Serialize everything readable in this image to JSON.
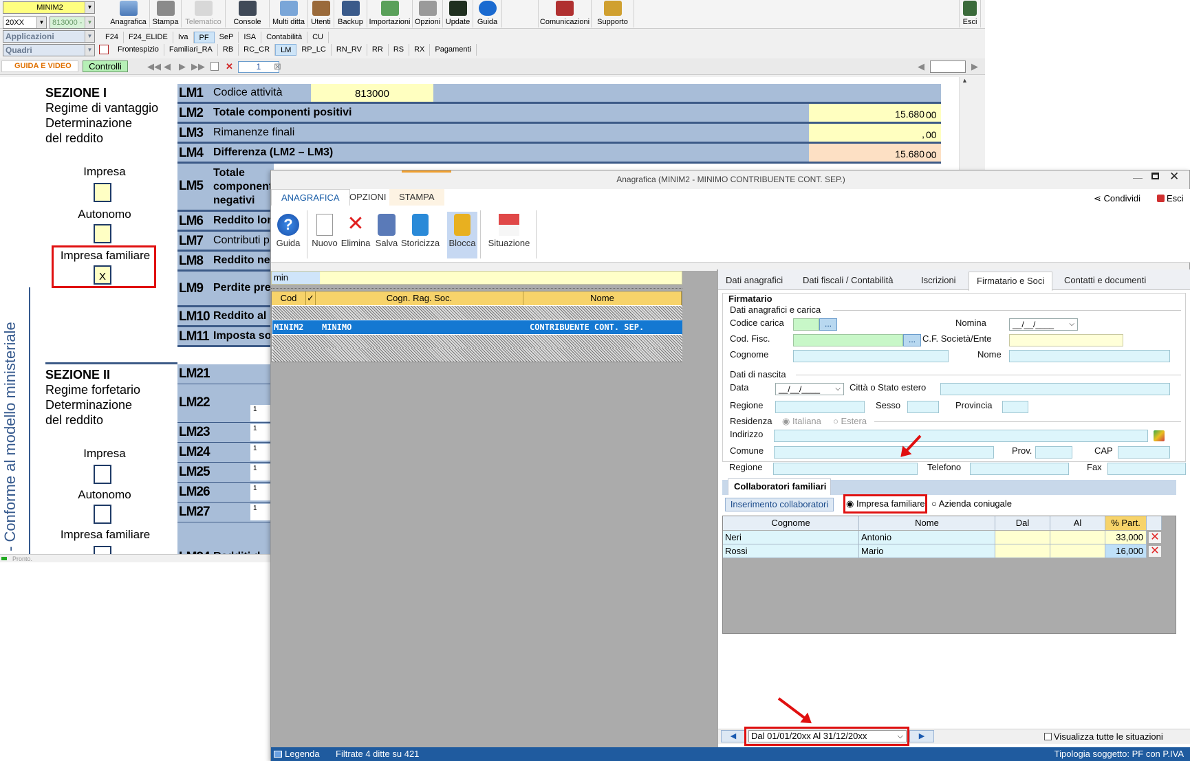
{
  "bg_app": {
    "company_combo": "MINIM2",
    "year_combo": "20XX",
    "code_combo": "813000 -",
    "applicazioni": "Applicazioni",
    "quadri": "Quadri",
    "toolbar": [
      "Anagrafica",
      "Stampa",
      "Telematico",
      "Console",
      "Multi ditta",
      "Utenti",
      "Backup",
      "Importazioni",
      "Opzioni",
      "Update",
      "Guida"
    ],
    "toolbar2": [
      "Comunicazioni",
      "Supporto"
    ],
    "esci": "Esci",
    "tabs1": [
      "F24",
      "F24_ELIDE",
      "Iva",
      "PF",
      "SeP",
      "ISA",
      "Contabilità",
      "CU"
    ],
    "tabs1_selected": "PF",
    "tabs2": [
      "Frontespizio",
      "Familiari_RA",
      "RB",
      "RC_CR",
      "LM",
      "RP_LC",
      "RN_RV",
      "RR",
      "RS",
      "RX",
      "Pagamenti"
    ],
    "tabs2_selected": "LM",
    "guida_video": "GUIDA E VIDEO",
    "controlli": "Controlli",
    "page_num": "1",
    "status": "Pronto.",
    "form": {
      "sez1_title": "SEZIONE I",
      "sez1_lines": [
        "Regime di vantaggio",
        "Determinazione",
        "del reddito"
      ],
      "impresa": "Impresa",
      "autonomo": "Autonomo",
      "impresa_familiare": "Impresa familiare",
      "x_mark": "X",
      "sez2_title": "SEZIONE II",
      "sez2_lines": [
        "Regime forfetario",
        "Determinazione",
        "del reddito"
      ],
      "side_text": "- Conforme al modello ministeriale",
      "lm1": "LM1",
      "lm1_text": "Codice attività",
      "lm1_value": "813000",
      "lm2": "LM2",
      "lm2_text": "Totale componenti positivi",
      "lm2_value": "15.680",
      "lm3": "LM3",
      "lm3_text": "Rimanenze finali",
      "lm3_value": ",",
      "lm4": "LM4",
      "lm4_text": "Differenza (LM2 – LM3)",
      "lm4_value": "15.680",
      "lm5": "LM5",
      "lm5_text": [
        "Totale",
        "component",
        "negativi"
      ],
      "lm6": "LM6",
      "lm6_text": "Reddito lor",
      "lm7": "LM7",
      "lm7_text": "Contributi p",
      "lm8": "LM8",
      "lm8_text": "Reddito net",
      "lm9": "LM9",
      "lm9_text": "Perdite pre",
      "lm10": "LM10",
      "lm10_text": "Reddito al",
      "lm11": "LM11",
      "lm11_text": "Imposta so",
      "lm21": "LM21",
      "lm22": "LM22",
      "lm23": "LM23",
      "lm24": "LM24",
      "lm25": "LM25",
      "lm26": "LM26",
      "lm27": "LM27",
      "lm34": "LM34",
      "lm34_text": "Redditi d",
      "one": "1",
      "dec_suffix": "00"
    }
  },
  "dialog": {
    "title": "Anagrafica (MINIM2 - MINIMO CONTRIBUENTE CONT. SEP.)",
    "ribbon_tabs": [
      "ANAGRAFICA",
      "OPZIONI",
      "STAMPA"
    ],
    "ribbon_selected": "ANAGRAFICA",
    "condividi": "Condividi",
    "esci": "Esci",
    "ribbon_buttons": [
      "Guida",
      "Nuovo",
      "Elimina",
      "Salva",
      "Storicizza",
      "Blocca",
      "Situazione"
    ],
    "search_value": "min",
    "grid_headers": [
      "Cod",
      "✓",
      "Cogn. Rag. Soc.",
      "Nome"
    ],
    "grid_selected": {
      "cod": "MINIM2",
      "cogn": "MINIMO",
      "nome": "CONTRIBUENTE CONT. SEP."
    },
    "section_tabs": [
      "Dati anagrafici",
      "Dati fiscali / Contabilità",
      "Iscrizioni",
      "Firmatario e Soci",
      "Contatti e documenti"
    ],
    "section_selected": "Firmatario e Soci",
    "firmatario": {
      "title": "Firmatario",
      "grp1": "Dati anagrafici e carica",
      "codice_carica": "Codice carica",
      "nomina": "Nomina",
      "date_placeholder": "__/__/____",
      "cod_fisc": "Cod. Fisc.",
      "cf_soc": "C.F. Società/Ente",
      "cognome": "Cognome",
      "nome": "Nome",
      "grp2": "Dati di nascita",
      "data": "Data",
      "citta": "Città o Stato estero",
      "regione": "Regione",
      "sesso": "Sesso",
      "provincia": "Provincia",
      "residenza": "Residenza",
      "italiana": "Italiana",
      "estera": "Estera",
      "indirizzo": "Indirizzo",
      "comune": "Comune",
      "prov": "Prov.",
      "cap": "CAP",
      "regione2": "Regione",
      "telefono": "Telefono",
      "fax": "Fax",
      "dots": "..."
    },
    "collab": {
      "tab": "Collaboratori familiari",
      "inserimento": "Inserimento collaboratori",
      "opt_impresa": "Impresa familiare",
      "opt_azienda": "Azienda coniugale",
      "selected_option": "Impresa familiare",
      "headers": [
        "Cognome",
        "Nome",
        "Dal",
        "Al",
        "% Part."
      ],
      "rows": [
        {
          "cognome": "Neri",
          "nome": "Antonio",
          "dal": "",
          "al": "",
          "part": "33,000"
        },
        {
          "cognome": "Rossi",
          "nome": "Mario",
          "dal": "",
          "al": "",
          "part": "16,000"
        }
      ]
    },
    "period": "Dal 01/01/20xx  Al 31/12/20xx",
    "visualizza": "Visualizza tutte le situazioni",
    "status_legenda": "Legenda",
    "status_filtrate": "Filtrate 4 ditte su 421",
    "status_tipologia": "Tipologia soggetto: PF con P.IVA"
  },
  "colors": {
    "accent_blue": "#1478d2",
    "highlight_red": "#e01010",
    "grid_header": "#f7d36a",
    "statusbar": "#1f5b9f"
  }
}
